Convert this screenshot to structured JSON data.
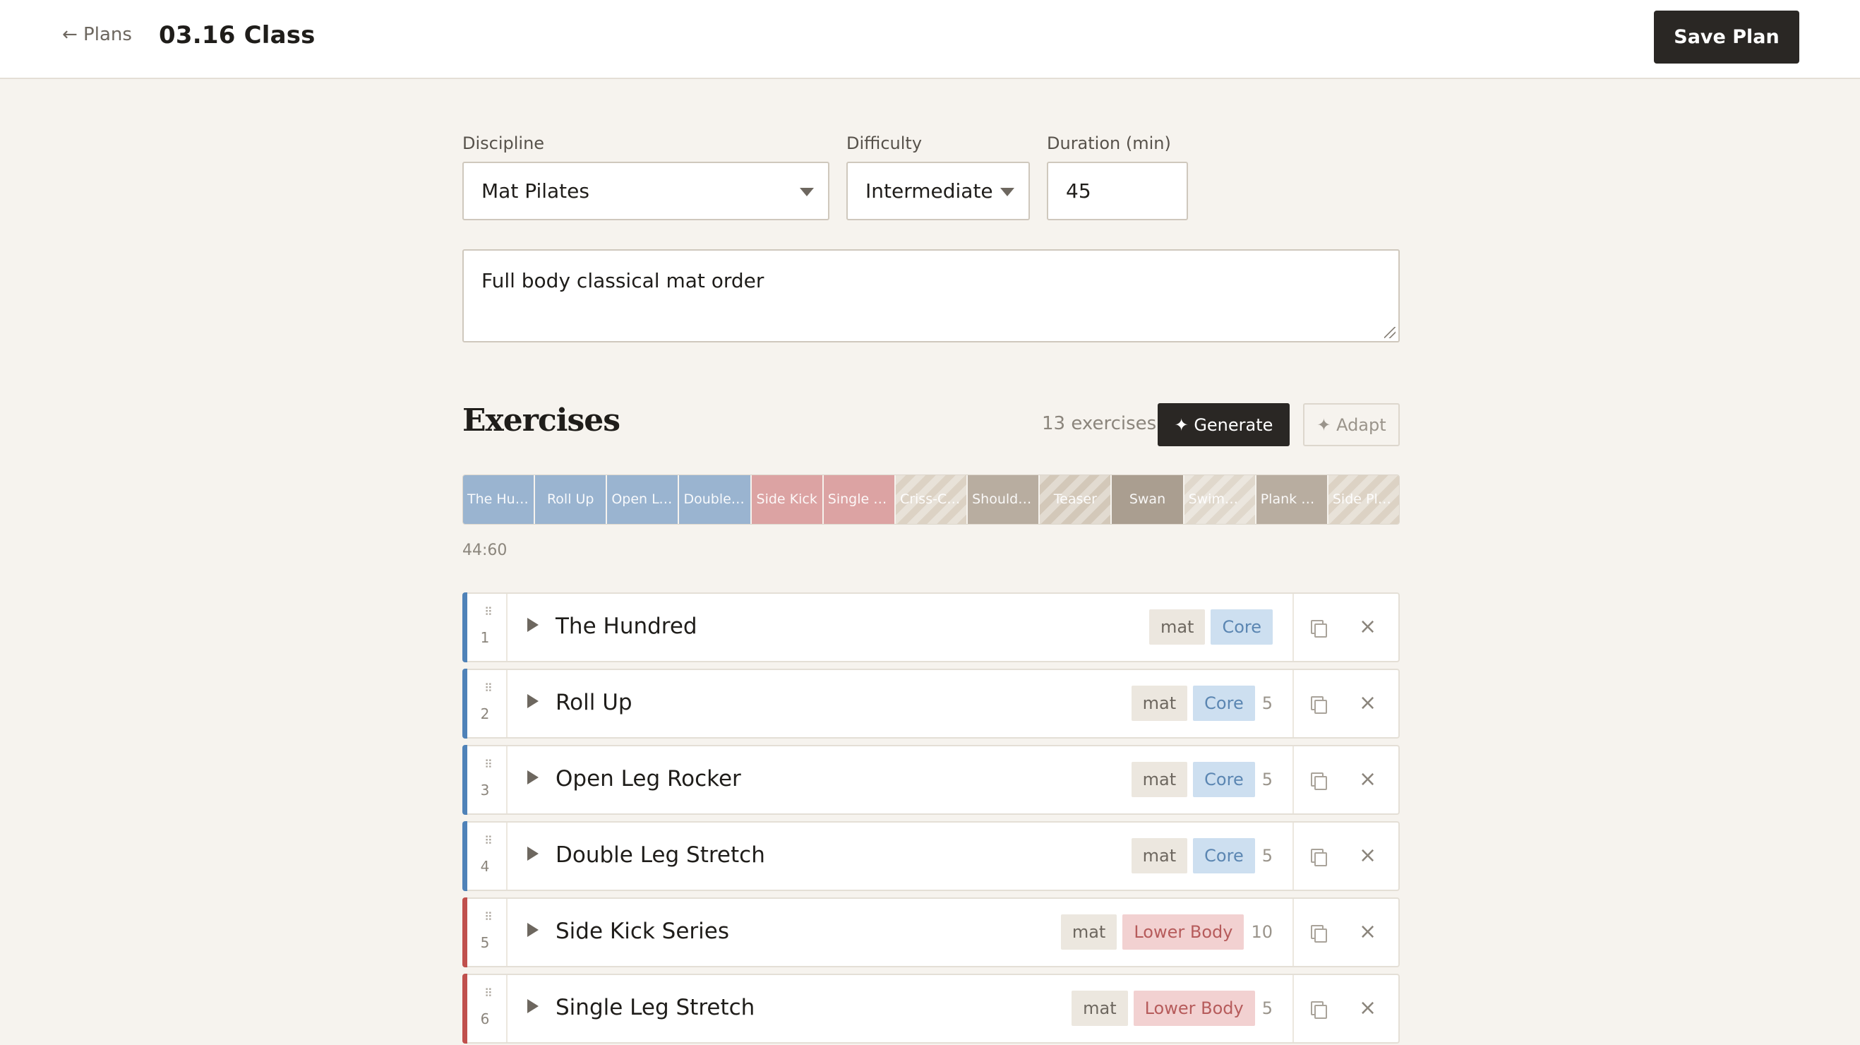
{
  "header": {
    "back_label": "← Plans",
    "title": "03.16 Class",
    "save_label": "Save Plan"
  },
  "form": {
    "discipline_label": "Discipline",
    "discipline_value": "Mat Pilates",
    "difficulty_label": "Difficulty",
    "difficulty_value": "Intermediate",
    "duration_label": "Duration (min)",
    "duration_value": "45",
    "notes_value": "Full body classical mat order"
  },
  "exercises_section": {
    "title": "Exercises",
    "count_label": "13 exercises",
    "generate_label": "✦ Generate",
    "adapt_label": "✦ Adapt",
    "total_time": "44:60"
  },
  "timeline": [
    {
      "label": "The Hundred",
      "color": "#9ab4d0",
      "hatched": false
    },
    {
      "label": "Roll Up",
      "color": "#9ab4d0",
      "hatched": false
    },
    {
      "label": "Open Leg Rocker",
      "color": "#9ab4d0",
      "hatched": false
    },
    {
      "label": "Double Leg Stretch",
      "color": "#9ab4d0",
      "hatched": false
    },
    {
      "label": "Side Kick",
      "color": "#dca3a3",
      "hatched": false
    },
    {
      "label": "Single Leg Stretch",
      "color": "#dca3a3",
      "hatched": false
    },
    {
      "label": "Criss-Cross",
      "color": "#dcd2c4",
      "hatched": true
    },
    {
      "label": "Shoulder Bridge",
      "color": "#b8ada0",
      "hatched": false
    },
    {
      "label": "Teaser",
      "color": "#d3c8b9",
      "hatched": true
    },
    {
      "label": "Swan",
      "color": "#aa9e90",
      "hatched": false
    },
    {
      "label": "Swimming",
      "color": "#e0d8cc",
      "hatched": true
    },
    {
      "label": "Plank Series",
      "color": "#b8ada0",
      "hatched": false
    },
    {
      "label": "Side Plank",
      "color": "#dcd2c4",
      "hatched": true
    }
  ],
  "exercises": [
    {
      "number": "1",
      "name": "The Hundred",
      "equipment": "mat",
      "category": "Core",
      "reps": "",
      "accent": "#4f82b8"
    },
    {
      "number": "2",
      "name": "Roll Up",
      "equipment": "mat",
      "category": "Core",
      "reps": "5",
      "accent": "#4f82b8"
    },
    {
      "number": "3",
      "name": "Open Leg Rocker",
      "equipment": "mat",
      "category": "Core",
      "reps": "5",
      "accent": "#4f82b8"
    },
    {
      "number": "4",
      "name": "Double Leg Stretch",
      "equipment": "mat",
      "category": "Core",
      "reps": "5",
      "accent": "#4f82b8"
    },
    {
      "number": "5",
      "name": "Side Kick Series",
      "equipment": "mat",
      "category": "Lower Body",
      "reps": "10",
      "accent": "#c0504d"
    },
    {
      "number": "6",
      "name": "Single Leg Stretch",
      "equipment": "mat",
      "category": "Lower Body",
      "reps": "5",
      "accent": "#c0504d"
    }
  ]
}
